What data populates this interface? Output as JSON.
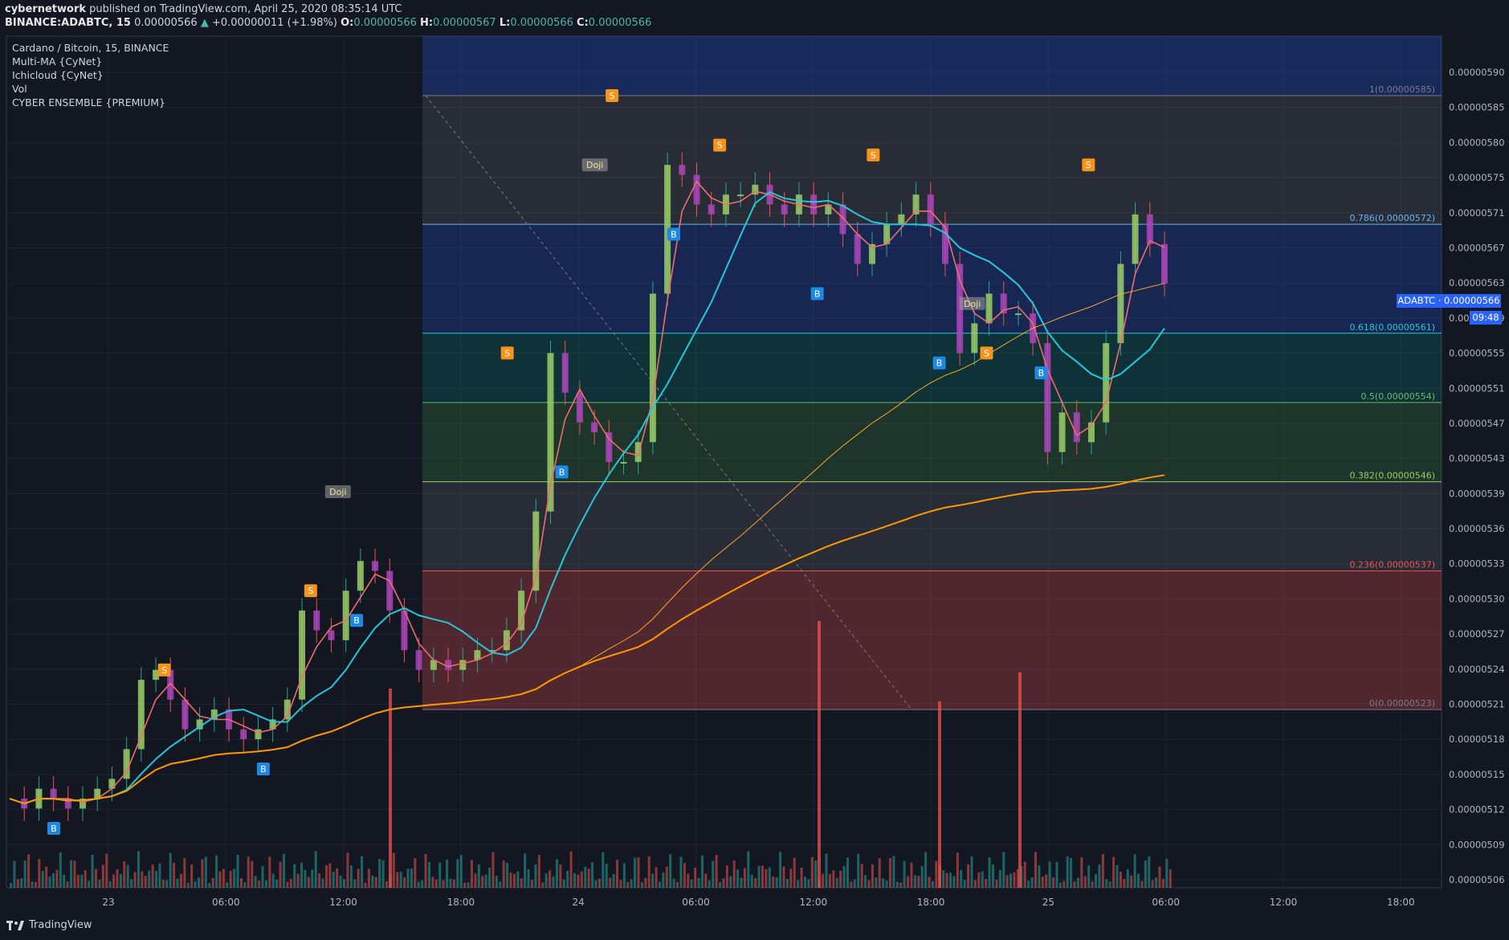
{
  "header": {
    "author": "cybernetwork",
    "published": "published on TradingView.com, April 25, 2020 08:35:14 UTC",
    "symbol": "BINANCE:ADABTC, 15",
    "last": "0.00000566",
    "change": "+0.00000011 (+1.98%)",
    "o_label": "O:",
    "o": "0.00000566",
    "h_label": "H:",
    "h": "0.00000567",
    "l_label": "L:",
    "l": "0.00000566",
    "c_label": "C:",
    "c": "0.00000566"
  },
  "legend": {
    "title": "Cardano / Bitcoin, 15, BINANCE",
    "indicators": [
      "Multi-MA {CyNet}",
      "Ichicloud {CyNet}",
      "Vol",
      "CYBER ENSEMBLE {PREMIUM}"
    ]
  },
  "price_badge": "ADABTC · 0.00000566",
  "timer_badge": "09:48",
  "footer": {
    "brand": "TradingView"
  },
  "colors": {
    "background": "#131722",
    "up": "#26a69a",
    "down": "#ef5350",
    "ma_fast": "#ef6c6c",
    "ma_mid": "#26c6da",
    "ma_slow": "#ff9800",
    "buy": "#1e88e5",
    "sell": "#f7931a"
  },
  "chart_data": {
    "type": "candlestick",
    "title": "Cardano / Bitcoin, 15, BINANCE",
    "y_ticks": [
      "0.00000590",
      "0.00000585",
      "0.00000580",
      "0.00000575",
      "0.00000571",
      "0.00000567",
      "0.00000563",
      "0.00000559",
      "0.00000555",
      "0.00000551",
      "0.00000547",
      "0.00000543",
      "0.00000539",
      "0.00000536",
      "0.00000533",
      "0.00000530",
      "0.00000527",
      "0.00000524",
      "0.00000521",
      "0.00000518",
      "0.00000515",
      "0.00000512",
      "0.00000509",
      "0.00000506"
    ],
    "x_ticks": [
      "23",
      "06:00",
      "12:00",
      "18:00",
      "24",
      "06:00",
      "12:00",
      "18:00",
      "25",
      "06:00",
      "12:00",
      "18:00"
    ],
    "ylim": [
      5.05e-06,
      5.91e-06
    ],
    "fib_levels": [
      {
        "label": "1(0.00000585)",
        "value": 5.85e-06,
        "color": "#787b86"
      },
      {
        "label": "0.786(0.00000572)",
        "value": 5.72e-06,
        "color": "#64b5f6"
      },
      {
        "label": "0.618(0.00000561)",
        "value": 5.61e-06,
        "color": "#26c6da"
      },
      {
        "label": "0.5(0.00000554)",
        "value": 5.54e-06,
        "color": "#66bb6a"
      },
      {
        "label": "0.382(0.00000546)",
        "value": 5.46e-06,
        "color": "#9ccc65"
      },
      {
        "label": "0.236(0.00000537)",
        "value": 5.37e-06,
        "color": "#ef5350"
      },
      {
        "label": "0(0.00000523)",
        "value": 5.23e-06,
        "color": "#787b86"
      }
    ],
    "close_series": [
      5.14e-06,
      5.13e-06,
      5.15e-06,
      5.14e-06,
      5.13e-06,
      5.14e-06,
      5.15e-06,
      5.16e-06,
      5.19e-06,
      5.26e-06,
      5.27e-06,
      5.24e-06,
      5.21e-06,
      5.22e-06,
      5.23e-06,
      5.21e-06,
      5.2e-06,
      5.21e-06,
      5.22e-06,
      5.24e-06,
      5.33e-06,
      5.31e-06,
      5.3e-06,
      5.35e-06,
      5.38e-06,
      5.37e-06,
      5.33e-06,
      5.29e-06,
      5.27e-06,
      5.28e-06,
      5.27e-06,
      5.28e-06,
      5.29e-06,
      5.29e-06,
      5.31e-06,
      5.35e-06,
      5.43e-06,
      5.59e-06,
      5.55e-06,
      5.52e-06,
      5.51e-06,
      5.48e-06,
      5.48e-06,
      5.5e-06,
      5.65e-06,
      5.78e-06,
      5.77e-06,
      5.74e-06,
      5.73e-06,
      5.75e-06,
      5.75e-06,
      5.76e-06,
      5.74e-06,
      5.73e-06,
      5.75e-06,
      5.73e-06,
      5.74e-06,
      5.71e-06,
      5.68e-06,
      5.7e-06,
      5.72e-06,
      5.73e-06,
      5.75e-06,
      5.72e-06,
      5.68e-06,
      5.59e-06,
      5.62e-06,
      5.65e-06,
      5.63e-06,
      5.63e-06,
      5.6e-06,
      5.49e-06,
      5.53e-06,
      5.5e-06,
      5.52e-06,
      5.6e-06,
      5.68e-06,
      5.73e-06,
      5.7e-06,
      5.66e-06
    ],
    "signals": [
      {
        "type": "B",
        "x": 0.033,
        "y": 5.11e-06
      },
      {
        "type": "S",
        "x": 0.11,
        "y": 5.27e-06
      },
      {
        "type": "B",
        "x": 0.179,
        "y": 5.17e-06
      },
      {
        "type": "S",
        "x": 0.212,
        "y": 5.35e-06
      },
      {
        "type": "B",
        "x": 0.244,
        "y": 5.32e-06
      },
      {
        "type": "S",
        "x": 0.349,
        "y": 5.59e-06
      },
      {
        "type": "B",
        "x": 0.387,
        "y": 5.47e-06
      },
      {
        "type": "S",
        "x": 0.422,
        "y": 5.85e-06
      },
      {
        "type": "B",
        "x": 0.465,
        "y": 5.71e-06
      },
      {
        "type": "S",
        "x": 0.497,
        "y": 5.8e-06
      },
      {
        "type": "B",
        "x": 0.565,
        "y": 5.65e-06
      },
      {
        "type": "S",
        "x": 0.604,
        "y": 5.79e-06
      },
      {
        "type": "B",
        "x": 0.65,
        "y": 5.58e-06
      },
      {
        "type": "S",
        "x": 0.683,
        "y": 5.59e-06
      },
      {
        "type": "B",
        "x": 0.721,
        "y": 5.57e-06
      },
      {
        "type": "S",
        "x": 0.754,
        "y": 5.78e-06
      }
    ],
    "doji_labels": [
      {
        "text": "Doji",
        "x": 0.231,
        "y": 5.45e-06
      },
      {
        "text": "Doji",
        "x": 0.41,
        "y": 5.78e-06
      },
      {
        "text": "Doji",
        "x": 0.673,
        "y": 5.64e-06
      }
    ],
    "volume_spikes": [
      0.62,
      0.83,
      0.58,
      0.67
    ]
  }
}
